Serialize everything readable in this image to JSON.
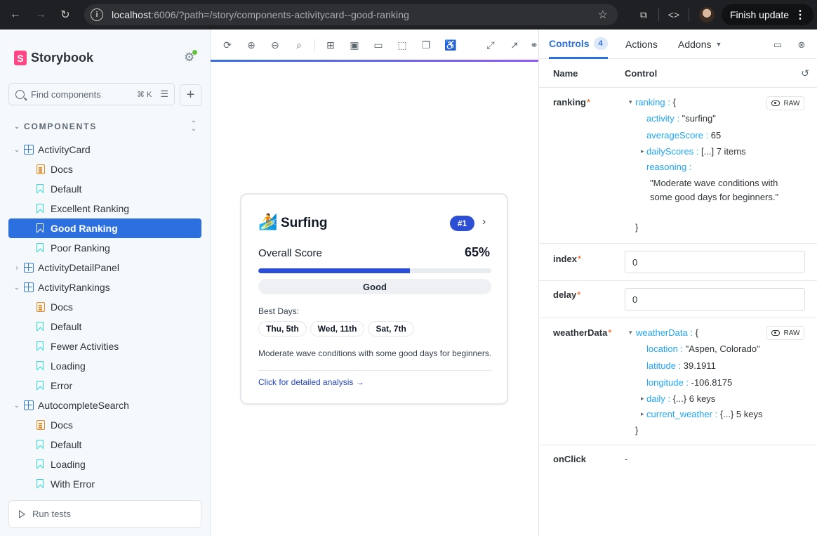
{
  "browser": {
    "url_host": "localhost",
    "url_rest": ":6006/?path=/story/components-activitycard--good-ranking",
    "finish_update_label": "Finish update"
  },
  "sidebar": {
    "brand": "Storybook",
    "search_placeholder": "Find components",
    "search_shortcut": "⌘ K",
    "section_title": "COMPONENTS",
    "tree": [
      {
        "label": "ActivityCard",
        "type": "component",
        "level": 0,
        "expanded": true
      },
      {
        "label": "Docs",
        "type": "docs",
        "level": 1
      },
      {
        "label": "Default",
        "type": "story",
        "level": 1
      },
      {
        "label": "Excellent Ranking",
        "type": "story",
        "level": 1
      },
      {
        "label": "Good Ranking",
        "type": "story",
        "level": 1,
        "active": true
      },
      {
        "label": "Poor Ranking",
        "type": "story",
        "level": 1
      },
      {
        "label": "ActivityDetailPanel",
        "type": "component",
        "level": 0,
        "expanded": false
      },
      {
        "label": "ActivityRankings",
        "type": "component",
        "level": 0,
        "expanded": true
      },
      {
        "label": "Docs",
        "type": "docs",
        "level": 1
      },
      {
        "label": "Default",
        "type": "story",
        "level": 1
      },
      {
        "label": "Fewer Activities",
        "type": "story",
        "level": 1
      },
      {
        "label": "Loading",
        "type": "story",
        "level": 1
      },
      {
        "label": "Error",
        "type": "story",
        "level": 1
      },
      {
        "label": "AutocompleteSearch",
        "type": "component",
        "level": 0,
        "expanded": true
      },
      {
        "label": "Docs",
        "type": "docs",
        "level": 1
      },
      {
        "label": "Default",
        "type": "story",
        "level": 1
      },
      {
        "label": "Loading",
        "type": "story",
        "level": 1
      },
      {
        "label": "With Error",
        "type": "story",
        "level": 1
      }
    ],
    "run_tests_label": "Run tests"
  },
  "card": {
    "emoji": "🏄",
    "title": "Surfing",
    "rank": "#1",
    "score_label": "Overall Score",
    "score_value": "65%",
    "score_fraction": 0.65,
    "rating": "Good",
    "best_days_label": "Best Days:",
    "best_days": [
      "Thu, 5th",
      "Wed, 11th",
      "Sat, 7th"
    ],
    "reasoning": "Moderate wave conditions with some good days for beginners.",
    "link": "Click for detailed analysis →",
    "accent_color": "#2b4ed4"
  },
  "panel": {
    "tabs": {
      "controls": "Controls",
      "controls_count": "4",
      "actions": "Actions",
      "addons": "Addons"
    },
    "headers": {
      "name": "Name",
      "control": "Control"
    },
    "raw_label": "RAW",
    "ranking": {
      "name": "ranking",
      "root": "ranking",
      "activity_key": "activity",
      "activity_value": "\"surfing\"",
      "average_key": "averageScore",
      "average_value": "65",
      "daily_key": "dailyScores",
      "daily_summary": "[...] 7 items",
      "reasoning_key": "reasoning",
      "reasoning_line1": "\"Moderate wave conditions with",
      "reasoning_line2": "some good days for beginners.\""
    },
    "index": {
      "name": "index",
      "value": "0"
    },
    "delay": {
      "name": "delay",
      "value": "0"
    },
    "weatherData": {
      "name": "weatherData",
      "root": "weatherData",
      "location_key": "location",
      "location_value": "\"Aspen, Colorado\"",
      "latitude_key": "latitude",
      "latitude_value": "39.1911",
      "longitude_key": "longitude",
      "longitude_value": "-106.8175",
      "daily_key": "daily",
      "daily_summary": "{...} 6 keys",
      "current_key": "current_weather",
      "current_summary": "{...} 5 keys"
    },
    "onClick": {
      "name": "onClick",
      "value": "-"
    }
  }
}
